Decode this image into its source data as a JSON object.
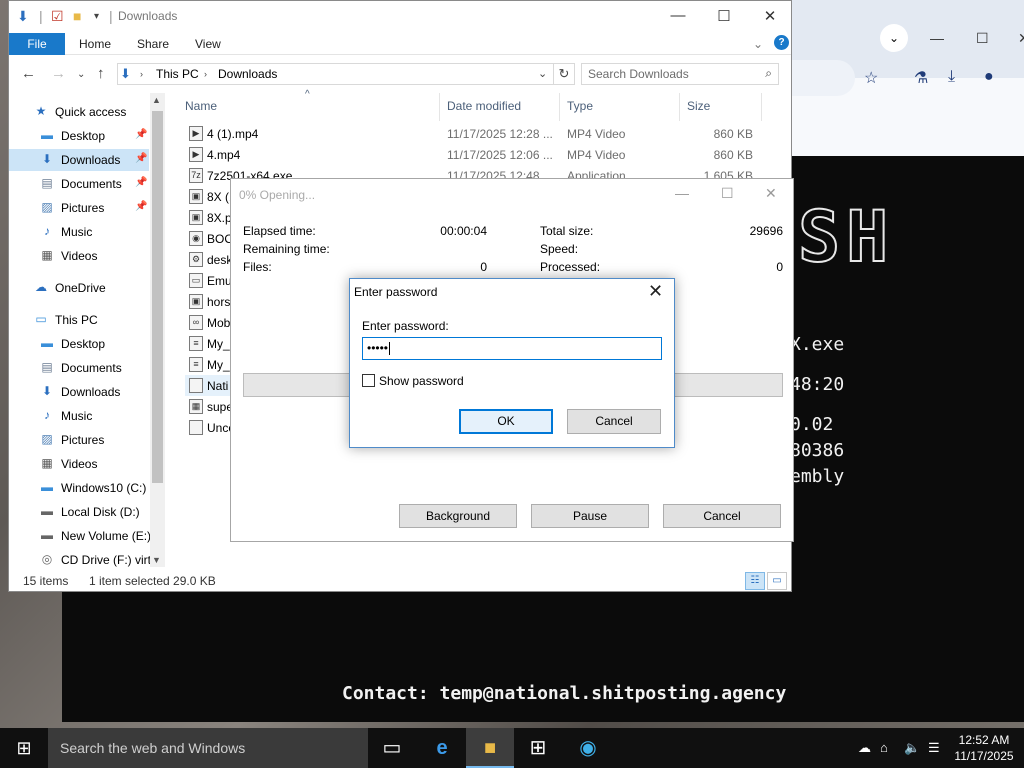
{
  "browser": {
    "controls": [
      "⌄",
      "—",
      "☐",
      "✕"
    ],
    "toolbar_icons": [
      "star-icon",
      "lab-icon",
      "download-icon",
      "profile-icon"
    ]
  },
  "console": {
    "banner": "SH",
    "lines": [
      "X.exe",
      "48:20",
      "0.02",
      "80386",
      "embly"
    ],
    "contact": "Contact: temp@national.shitposting.agency"
  },
  "explorer": {
    "title": "Downloads",
    "ribbon_tabs": [
      "File",
      "Home",
      "Share",
      "View"
    ],
    "address": {
      "segments": [
        "This PC",
        "Downloads"
      ]
    },
    "search_placeholder": "Search Downloads",
    "nav": [
      {
        "label": "Quick access",
        "icon": "star-icon",
        "indent": 0
      },
      {
        "label": "Desktop",
        "icon": "desktop-folder-icon",
        "indent": 1,
        "pinned": true
      },
      {
        "label": "Downloads",
        "icon": "download-folder-icon",
        "indent": 1,
        "pinned": true,
        "selected": true
      },
      {
        "label": "Documents",
        "icon": "documents-folder-icon",
        "indent": 1,
        "pinned": true
      },
      {
        "label": "Pictures",
        "icon": "pictures-folder-icon",
        "indent": 1,
        "pinned": true
      },
      {
        "label": "Music",
        "icon": "music-icon",
        "indent": 1
      },
      {
        "label": "Videos",
        "icon": "videos-folder-icon",
        "indent": 1
      },
      {
        "label": "OneDrive",
        "icon": "cloud-icon",
        "indent": 0
      },
      {
        "label": "This PC",
        "icon": "computer-icon",
        "indent": 0
      },
      {
        "label": "Desktop",
        "icon": "desktop-folder-icon",
        "indent": 1
      },
      {
        "label": "Documents",
        "icon": "documents-folder-icon",
        "indent": 1
      },
      {
        "label": "Downloads",
        "icon": "download-folder-icon",
        "indent": 1
      },
      {
        "label": "Music",
        "icon": "music-icon",
        "indent": 1
      },
      {
        "label": "Pictures",
        "icon": "pictures-folder-icon",
        "indent": 1
      },
      {
        "label": "Videos",
        "icon": "videos-folder-icon",
        "indent": 1
      },
      {
        "label": "Windows10 (C:)",
        "icon": "windows-drive-icon",
        "indent": 1
      },
      {
        "label": "Local Disk (D:)",
        "icon": "drive-icon",
        "indent": 1
      },
      {
        "label": "New Volume (E:)",
        "icon": "drive-icon",
        "indent": 1
      },
      {
        "label": "CD Drive (F:) virt",
        "icon": "cd-drive-icon",
        "indent": 1
      }
    ],
    "columns": [
      "Name",
      "Date modified",
      "Type",
      "Size"
    ],
    "files": [
      {
        "name": "4 (1).mp4",
        "date": "11/17/2025 12:28 ...",
        "type": "MP4 Video",
        "size": "860 KB",
        "icon": "video-file-icon"
      },
      {
        "name": "4.mp4",
        "date": "11/17/2025 12:06 ...",
        "type": "MP4 Video",
        "size": "860 KB",
        "icon": "video-file-icon"
      },
      {
        "name": "7z2501-x64.exe",
        "date": "11/17/2025 12:48 ...",
        "type": "Application",
        "size": "1,605 KB",
        "icon": "7zip-icon"
      },
      {
        "name": "8X (1",
        "date": "",
        "type": "",
        "size": "",
        "icon": "image-file-icon"
      },
      {
        "name": "8X.p",
        "date": "",
        "type": "",
        "size": "",
        "icon": "image-file-icon"
      },
      {
        "name": "BOO",
        "date": "",
        "type": "",
        "size": "",
        "icon": "disk-image-icon"
      },
      {
        "name": "desk",
        "date": "",
        "type": "",
        "size": "",
        "icon": "settings-file-icon"
      },
      {
        "name": "Emu",
        "date": "",
        "type": "",
        "size": "",
        "icon": "app-file-icon"
      },
      {
        "name": "hors",
        "date": "",
        "type": "",
        "size": "",
        "icon": "image-file-icon"
      },
      {
        "name": "Mob",
        "date": "",
        "type": "",
        "size": "",
        "icon": "visual-studio-icon"
      },
      {
        "name": "My_",
        "date": "",
        "type": "",
        "size": "",
        "icon": "document-file-icon"
      },
      {
        "name": "My_",
        "date": "",
        "type": "",
        "size": "",
        "icon": "document-file-icon"
      },
      {
        "name": "Nati",
        "date": "",
        "type": "",
        "size": "",
        "icon": "blank-file-icon",
        "selected": true
      },
      {
        "name": "supe",
        "date": "",
        "type": "",
        "size": "",
        "icon": "archive-icon"
      },
      {
        "name": "Unco",
        "date": "",
        "type": "",
        "size": "",
        "icon": "blank-file-icon"
      }
    ],
    "status": {
      "count": "15 items",
      "selection": "1 item selected  29.0 KB"
    }
  },
  "progress": {
    "title": "0% Opening...",
    "percent": 0,
    "elapsed_label": "Elapsed time:",
    "elapsed": "00:00:04",
    "remaining_label": "Remaining time:",
    "files_label": "Files:",
    "files": "0",
    "total_label": "Total size:",
    "total": "29696",
    "speed_label": "Speed:",
    "processed_label": "Processed:",
    "processed": "0",
    "buttons": {
      "background": "Background",
      "pause": "Pause",
      "cancel": "Cancel"
    }
  },
  "password_dialog": {
    "title": "Enter password",
    "label": "Enter password:",
    "value": "•••••",
    "show_password_label": "Show password",
    "show_password_checked": false,
    "ok": "OK",
    "cancel": "Cancel"
  },
  "taskbar": {
    "search_placeholder": "Search the web and Windows",
    "time": "12:52 AM",
    "date": "11/17/2025"
  },
  "colors": {
    "accent": "#0078d7",
    "ribbon_file": "#1979ca",
    "selection": "#cce4f7"
  }
}
